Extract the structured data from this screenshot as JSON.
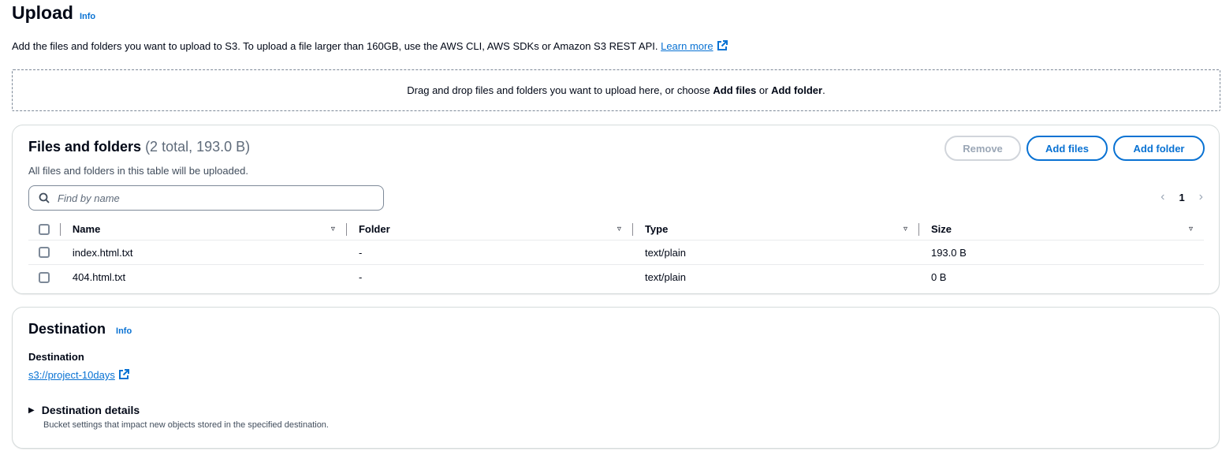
{
  "header": {
    "title": "Upload",
    "info": "Info"
  },
  "description": {
    "text": "Add the files and folders you want to upload to S3. To upload a file larger than 160GB, use the AWS CLI, AWS SDKs or Amazon S3 REST API.",
    "learn_more": "Learn more"
  },
  "dropzone": {
    "prefix": "Drag and drop files and folders you want to upload here, or choose",
    "add_files": "Add files",
    "or": "or",
    "add_folder": "Add folder",
    "suffix": "."
  },
  "files_panel": {
    "title": "Files and folders",
    "count": "(2 total, 193.0 B)",
    "subtitle": "All files and folders in this table will be uploaded.",
    "buttons": {
      "remove": "Remove",
      "add_files": "Add files",
      "add_folder": "Add folder"
    },
    "search_placeholder": "Find by name",
    "page": "1",
    "columns": [
      "Name",
      "Folder",
      "Type",
      "Size"
    ],
    "rows": [
      {
        "name": "index.html.txt",
        "folder": "-",
        "type": "text/plain",
        "size": "193.0 B"
      },
      {
        "name": "404.html.txt",
        "folder": "-",
        "type": "text/plain",
        "size": "0 B"
      }
    ]
  },
  "destination_panel": {
    "title": "Destination",
    "info": "Info",
    "label": "Destination",
    "link": "s3://project-10days",
    "details_title": "Destination details",
    "details_sub": "Bucket settings that impact new objects stored in the specified destination."
  },
  "colors": {
    "link": "#0972d3",
    "text": "#000716",
    "muted": "#5f6b7a"
  }
}
